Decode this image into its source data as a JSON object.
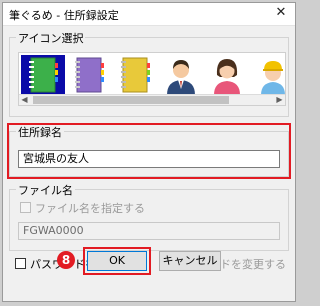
{
  "window": {
    "title": "筆ぐるめ - 住所録設定",
    "close_glyph": "✕"
  },
  "icon_group": {
    "label": "アイコン選択",
    "icons": [
      {
        "name": "green-notebook-icon",
        "selected": true
      },
      {
        "name": "purple-notebook-icon",
        "selected": false
      },
      {
        "name": "yellow-notebook-icon",
        "selected": false
      },
      {
        "name": "businessman-avatar-icon",
        "selected": false
      },
      {
        "name": "woman-avatar-icon",
        "selected": false
      },
      {
        "name": "child-avatar-icon",
        "selected": false
      }
    ]
  },
  "address_group": {
    "label": "住所録名",
    "name_value": "宮城県の友人"
  },
  "file_group": {
    "label": "ファイル名",
    "specify_checkbox_label": "ファイル名を指定する",
    "file_value": "FGWA0000"
  },
  "password": {
    "set_label": "パスワードを設定する",
    "change_label": "パスワードを変更する"
  },
  "buttons": {
    "ok": "OK",
    "cancel": "キャンセル"
  },
  "annotation": {
    "step": "8"
  },
  "colors": {
    "highlight": "#e21b23",
    "selection": "#0a0aa8"
  }
}
